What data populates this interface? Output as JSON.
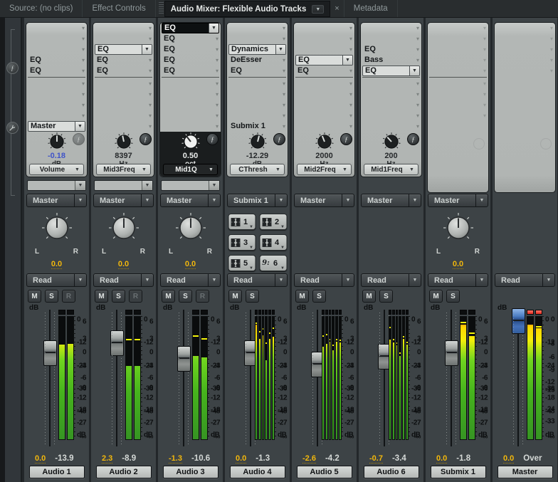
{
  "glyphs": {
    "dropdown_arrow": "▼",
    "slot_arrow": "▾",
    "close": "×",
    "fx": "ƒ"
  },
  "labels": {
    "db": "dB"
  },
  "colors": {
    "value_orange": "#f2b70c",
    "value_blue": "#3f53c9",
    "clip_red": "#df2a20",
    "meter_green": "#46b31d",
    "meter_yellow": "#f2ee0a",
    "master_handle_blue": "#4a7cc2"
  },
  "tab_bar": {
    "tabs": [
      {
        "label": "Source: (no clips)",
        "active": false
      },
      {
        "label": "Effect Controls",
        "active": false
      },
      {
        "label": "Audio Mixer: Flexible Audio Tracks",
        "active": true
      },
      {
        "label": "Metadata",
        "active": false
      }
    ]
  },
  "scales": {
    "track": [
      {
        "label": "6",
        "db": 6,
        "frac": 0.09
      },
      {
        "label": "3",
        "db": 3,
        "frac": 0.215
      },
      {
        "label": "0",
        "db": 0,
        "frac": 0.315
      },
      {
        "label": "-3",
        "db": -3,
        "frac": 0.41
      },
      {
        "label": "-6",
        "db": -6,
        "frac": 0.5
      },
      {
        "label": "-9",
        "db": -9,
        "frac": 0.575
      },
      {
        "label": "-12",
        "db": -12,
        "frac": 0.645
      },
      {
        "label": "-18",
        "db": -18,
        "frac": 0.735
      },
      {
        "label": "-27",
        "db": -27,
        "frac": 0.83
      },
      {
        "label": "-∞",
        "db": -60,
        "frac": 0.93
      }
    ],
    "master": [
      {
        "label": "0",
        "db": 0,
        "frac": 0.075
      },
      {
        "label": "-3",
        "db": -3,
        "frac": 0.25
      },
      {
        "label": "-6",
        "db": -6,
        "frac": 0.35
      },
      {
        "label": "-9",
        "db": -9,
        "frac": 0.445
      },
      {
        "label": "-12",
        "db": -12,
        "frac": 0.53
      },
      {
        "label": "-15",
        "db": -15,
        "frac": 0.59
      },
      {
        "label": "-18",
        "db": -18,
        "frac": 0.645
      },
      {
        "label": "-24",
        "db": -24,
        "frac": 0.73
      },
      {
        "label": "-33",
        "db": -33,
        "frac": 0.82
      },
      {
        "label": "-∞",
        "db": -60,
        "frac": 0.93
      }
    ],
    "meter": [
      {
        "label": "0",
        "frac": 0.03
      },
      {
        "label": "-12",
        "frac": 0.21
      },
      {
        "label": "-24",
        "frac": 0.4
      },
      {
        "label": "-36",
        "frac": 0.585
      },
      {
        "label": "-48",
        "frac": 0.77
      },
      {
        "label": "dB",
        "frac": 0.96
      }
    ]
  },
  "tracks": [
    {
      "name": "Audio 1",
      "effects": {
        "slots": [
          {
            "label": ""
          },
          {
            "label": ""
          },
          {
            "label": ""
          },
          {
            "label": "EQ"
          },
          {
            "label": "EQ"
          }
        ],
        "sends": [
          {
            "label": ""
          },
          {
            "label": ""
          },
          {
            "label": ""
          },
          {
            "label": ""
          },
          {
            "label": "Master",
            "style": "boxed"
          }
        ],
        "knob": {
          "value": "-0.18",
          "unit": "dB",
          "param": "Volume",
          "angle": 0,
          "value_blue": true,
          "bypass_dimmed": true
        }
      },
      "extra_send_dropdown": true,
      "output": "Master",
      "pan": {
        "type": "knob",
        "value": "0.0"
      },
      "automation": "Read",
      "track_buttons": [
        {
          "label": "M"
        },
        {
          "label": "S"
        },
        {
          "label": "R",
          "disabled": true
        }
      ],
      "fader": {
        "scale": "track",
        "value_db": 0
      },
      "meter": {
        "clip": [
          false,
          false
        ],
        "channels": [
          {
            "level": -12.8,
            "peak": null
          },
          {
            "level": -12.4,
            "peak": null
          }
        ]
      },
      "gain_label": "0.0",
      "peak_label": "-13.9"
    },
    {
      "name": "Audio 2",
      "effects": {
        "slots": [
          {
            "label": ""
          },
          {
            "label": ""
          },
          {
            "label": "EQ",
            "style": "boxed"
          },
          {
            "label": "EQ"
          },
          {
            "label": "EQ"
          }
        ],
        "sends": [
          {
            "label": ""
          },
          {
            "label": ""
          },
          {
            "label": ""
          },
          {
            "label": ""
          },
          {
            "label": ""
          }
        ],
        "knob": {
          "value": "8397",
          "unit": "Hz",
          "param": "Mid3Freq",
          "angle": -12
        }
      },
      "extra_send_dropdown": true,
      "output": "Master",
      "pan": {
        "type": "knob",
        "value": "0.0"
      },
      "automation": "Read",
      "track_buttons": [
        {
          "label": "M"
        },
        {
          "label": "S"
        },
        {
          "label": "R",
          "disabled": true
        }
      ],
      "fader": {
        "scale": "track",
        "value_db": 2.3
      },
      "meter": {
        "clip": [
          false,
          false
        ],
        "channels": [
          {
            "level": -24,
            "peak": -10
          },
          {
            "level": -24,
            "peak": -10
          }
        ]
      },
      "gain_label": "2.3",
      "peak_label": "-8.9"
    },
    {
      "name": "Audio 3",
      "effects": {
        "slots": [
          {
            "label": "EQ",
            "style": "dark"
          },
          {
            "label": "EQ"
          },
          {
            "label": "EQ"
          },
          {
            "label": "EQ"
          },
          {
            "label": "EQ"
          }
        ],
        "sends": [
          {
            "label": ""
          },
          {
            "label": ""
          },
          {
            "label": ""
          },
          {
            "label": ""
          },
          {
            "label": ""
          }
        ],
        "knob": {
          "value": "0.50",
          "unit": "oct",
          "param": "Mid1Q",
          "angle": -38,
          "dark": true,
          "white_knob": true
        }
      },
      "extra_send_dropdown": true,
      "output": "Master",
      "pan": {
        "type": "knob",
        "value": "0.0"
      },
      "automation": "Read",
      "track_buttons": [
        {
          "label": "M"
        },
        {
          "label": "S"
        },
        {
          "label": "R",
          "disabled": true
        }
      ],
      "fader": {
        "scale": "track",
        "value_db": -1.3
      },
      "meter": {
        "clip": [
          false,
          false
        ],
        "channels": [
          {
            "level": -19,
            "peak": -8
          },
          {
            "level": -19.5,
            "peak": -9.5
          }
        ]
      },
      "gain_label": "-1.3",
      "peak_label": "-10.6"
    },
    {
      "name": "Audio 4",
      "effects": {
        "slots": [
          {
            "label": ""
          },
          {
            "label": ""
          },
          {
            "label": "Dynamics",
            "style": "boxed"
          },
          {
            "label": "DeEsser"
          },
          {
            "label": "EQ"
          }
        ],
        "sends": [
          {
            "label": ""
          },
          {
            "label": ""
          },
          {
            "label": ""
          },
          {
            "label": ""
          },
          {
            "label": "Submix 1"
          }
        ],
        "knob": {
          "value": "-12.29",
          "unit": "dB",
          "param": "CThresh",
          "angle": 14
        }
      },
      "extra_send_dropdown": false,
      "output": "Submix 1",
      "pan": {
        "type": "buttons",
        "buttons": [
          {
            "label": "1",
            "icon": "speaker"
          },
          {
            "label": "2",
            "icon": "speaker"
          },
          {
            "label": "3",
            "icon": "speaker"
          },
          {
            "label": "4",
            "icon": "speaker"
          },
          {
            "label": "5",
            "icon": "speaker"
          },
          {
            "label": "6",
            "icon": "bass-clef",
            "clef": "9:"
          }
        ]
      },
      "automation": "Read",
      "track_buttons": [
        {
          "label": "M"
        },
        {
          "label": "S"
        }
      ],
      "fader": {
        "scale": "track",
        "value_db": 0
      },
      "meter": {
        "clip": [
          false,
          false,
          false,
          false,
          false,
          false
        ],
        "channels": [
          {
            "level": -2.5,
            "peak": -1.5
          },
          {
            "level": -10,
            "peak": -6
          },
          {
            "level": -8,
            "peak": -4.5
          },
          {
            "level": -21,
            "peak": -12
          },
          {
            "level": -10,
            "peak": -6.5
          },
          {
            "level": -9,
            "peak": -4
          }
        ]
      },
      "gain_label": "0.0",
      "peak_label": "-1.3"
    },
    {
      "name": "Audio 5",
      "effects": {
        "slots": [
          {
            "label": ""
          },
          {
            "label": ""
          },
          {
            "label": ""
          },
          {
            "label": "EQ",
            "style": "boxed"
          },
          {
            "label": "EQ"
          }
        ],
        "sends": [
          {
            "label": ""
          },
          {
            "label": ""
          },
          {
            "label": ""
          },
          {
            "label": ""
          },
          {
            "label": ""
          }
        ],
        "knob": {
          "value": "2000",
          "unit": "Hz",
          "param": "Mid2Freq",
          "angle": -22
        }
      },
      "extra_send_dropdown": false,
      "output": "Master",
      "pan": {
        "type": "none"
      },
      "automation": "Read",
      "track_buttons": [
        {
          "label": "M"
        },
        {
          "label": "S"
        }
      ],
      "fader": {
        "scale": "track",
        "value_db": -2.6
      },
      "meter": {
        "clip": [
          false,
          false,
          false,
          false,
          false,
          false
        ],
        "channels": [
          {
            "level": -14,
            "peak": -8
          },
          {
            "level": -12.5,
            "peak": -7.5
          },
          {
            "level": -11.5,
            "peak": -10
          },
          {
            "level": -16,
            "peak": -13
          },
          {
            "level": -11.5,
            "peak": -10
          },
          {
            "level": -12,
            "peak": -10.5
          }
        ]
      },
      "gain_label": "-2.6",
      "peak_label": "-4.2"
    },
    {
      "name": "Audio 6",
      "effects": {
        "slots": [
          {
            "label": ""
          },
          {
            "label": ""
          },
          {
            "label": "EQ"
          },
          {
            "label": "Bass"
          },
          {
            "label": "EQ",
            "style": "boxed"
          }
        ],
        "sends": [
          {
            "label": ""
          },
          {
            "label": ""
          },
          {
            "label": ""
          },
          {
            "label": ""
          },
          {
            "label": ""
          }
        ],
        "knob": {
          "value": "200",
          "unit": "Hz",
          "param": "Mid1Freq",
          "angle": -42
        }
      },
      "extra_send_dropdown": false,
      "output": "Master",
      "pan": {
        "type": "none"
      },
      "automation": "Read",
      "track_buttons": [
        {
          "label": "M"
        },
        {
          "label": "S"
        }
      ],
      "fader": {
        "scale": "track",
        "value_db": -0.7
      },
      "meter": {
        "clip": [
          false,
          false,
          false,
          false,
          false,
          false
        ],
        "channels": [
          {
            "level": -10.5,
            "peak": -3.5
          },
          {
            "level": -12,
            "peak": -10
          },
          {
            "level": -13.5,
            "peak": -12
          },
          {
            "level": -19,
            "peak": -17
          },
          {
            "level": -10,
            "peak": -8.5
          },
          {
            "level": -13,
            "peak": -11.5
          }
        ]
      },
      "gain_label": "-0.7",
      "peak_label": "-3.4"
    },
    {
      "name": "Submix 1",
      "effects": {
        "empty": true,
        "show_sends": true
      },
      "extra_send_dropdown": false,
      "output": "Master",
      "pan": {
        "type": "knob",
        "value": "0.0"
      },
      "automation": "Read",
      "track_buttons": [
        {
          "label": "M"
        },
        {
          "label": "S"
        }
      ],
      "fader": {
        "scale": "track",
        "value_db": 0
      },
      "meter": {
        "clip": [
          false,
          false
        ],
        "channels": [
          {
            "level": -2.5,
            "peak": -1.2
          },
          {
            "level": -8.5,
            "peak": -6.5
          }
        ]
      },
      "gain_label": "0.0",
      "peak_label": "-1.8"
    },
    {
      "name": "Master",
      "effects": {
        "empty": true,
        "show_sends": false
      },
      "extra_send_dropdown": false,
      "output": null,
      "pan": {
        "type": "none"
      },
      "automation": "Read",
      "track_buttons": [],
      "fader": {
        "scale": "master",
        "value_db": 0,
        "master_cap": true
      },
      "meter": {
        "clip": [
          true,
          true
        ],
        "channels": [
          {
            "level": -2.5,
            "peak": null
          },
          {
            "level": -4.3,
            "peak": -3.2
          }
        ]
      },
      "gain_label": "0.0",
      "peak_label": "Over",
      "peak_over": true
    }
  ]
}
